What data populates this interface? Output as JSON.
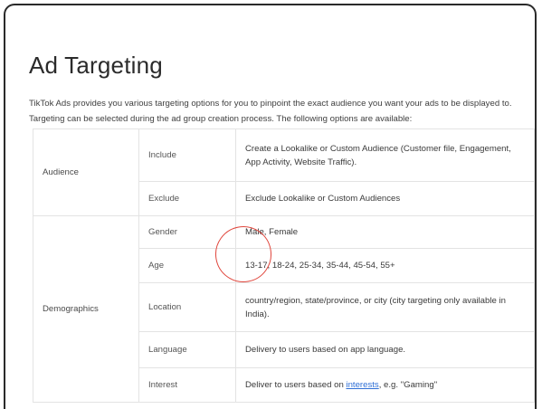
{
  "title": "Ad Targeting",
  "intro": "TikTok Ads provides you various targeting options for you to pinpoint the exact audience you want your ads to be displayed to. Targeting can be selected during the ad group creation process. The following options are available:",
  "table": {
    "audience": {
      "category": "Audience",
      "include_label": "Include",
      "include_desc": "Create a Lookalike or Custom Audience (Customer file, Engagement, App Activity, Website Traffic).",
      "exclude_label": "Exclude",
      "exclude_desc": "Exclude Lookalike or Custom Audiences"
    },
    "demographics": {
      "category": "Demographics",
      "gender_label": "Gender",
      "gender_desc": "Male, Female",
      "age_label": "Age",
      "age_desc": "13-17, 18-24, 25-34, 35-44, 45-54, 55+",
      "location_label": "Location",
      "location_desc": "country/region, state/province, or city (city targeting only available in India).",
      "language_label": "Language",
      "language_desc": "Delivery to users based on app language.",
      "interest_label": "Interest",
      "interest_desc_before": "Deliver to users based on ",
      "interest_link": "interests",
      "interest_desc_after": ", e.g. \"Gaming\""
    }
  },
  "annotation_color": "#e0453b"
}
